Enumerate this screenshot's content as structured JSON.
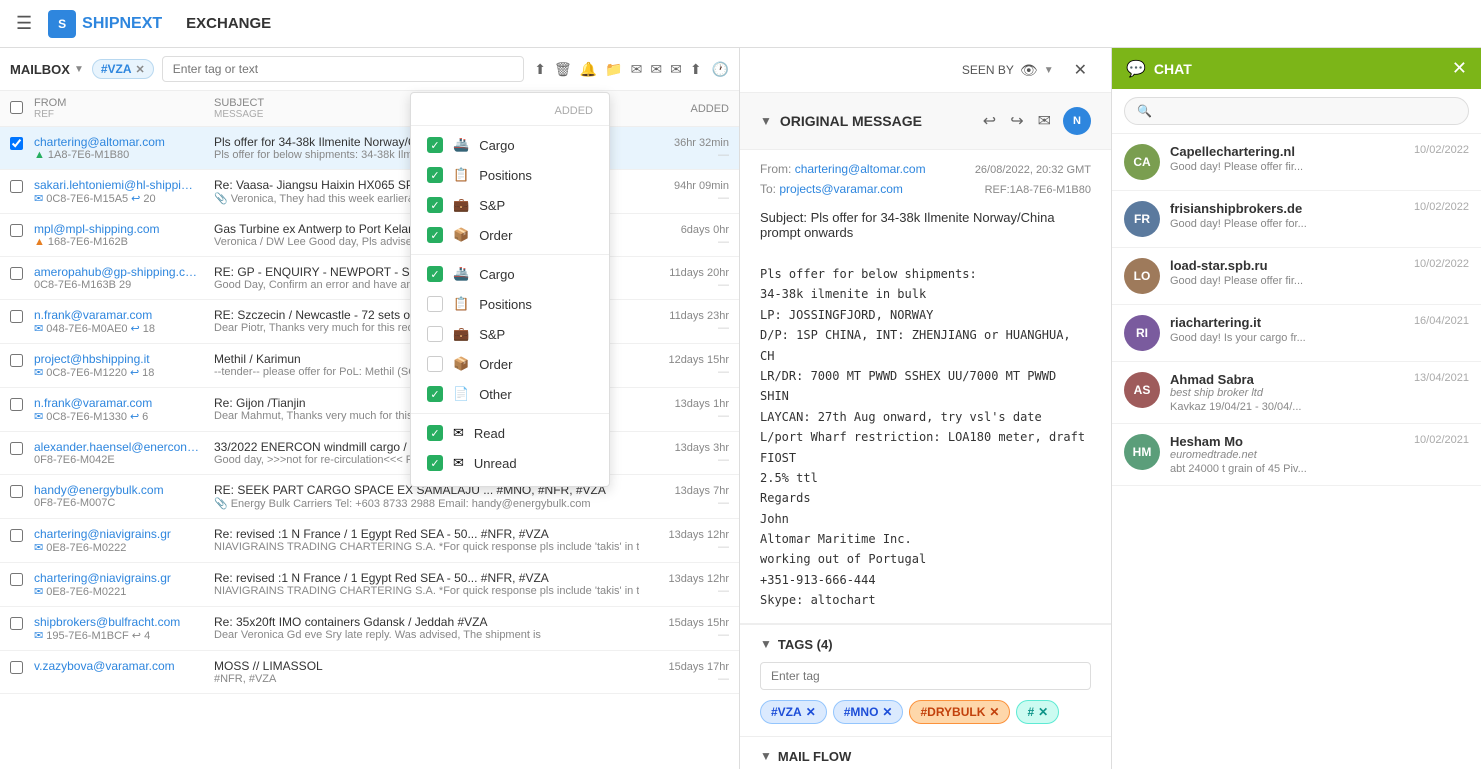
{
  "nav": {
    "hamburger": "☰",
    "logo_text": "SHIPNEXT",
    "title": "EXCHANGE"
  },
  "mailbox": {
    "label": "MAILBOX",
    "tag_chip": "#VZA",
    "search_placeholder": "Enter tag or text",
    "columns": {
      "from": "FROM",
      "ref": "REF",
      "subject": "SUBJECT",
      "message": "MESSAGE",
      "added": "ADDED"
    }
  },
  "dropdown": {
    "header_left": "",
    "header_right": "ADDED",
    "items": [
      {
        "id": "cargo1",
        "checked": true,
        "icon": "🚢",
        "label": "Cargo"
      },
      {
        "id": "positions",
        "checked": true,
        "icon": "📋",
        "label": "Positions"
      },
      {
        "id": "snp",
        "checked": true,
        "icon": "💼",
        "label": "S&P"
      },
      {
        "id": "order",
        "checked": true,
        "icon": "📦",
        "label": "Order"
      },
      {
        "id": "cargo2",
        "checked": true,
        "icon": "🚢",
        "label": "Cargo"
      },
      {
        "id": "positions2",
        "checked": false,
        "icon": "📋",
        "label": "Positions"
      },
      {
        "id": "snp2",
        "checked": false,
        "icon": "💼",
        "label": "S&P"
      },
      {
        "id": "order2",
        "checked": false,
        "icon": "📦",
        "label": "Order"
      },
      {
        "id": "other",
        "checked": true,
        "icon": "📄",
        "label": "Other"
      },
      {
        "id": "read",
        "checked": true,
        "icon": "✉",
        "label": "Read"
      },
      {
        "id": "unread",
        "checked": true,
        "icon": "✉",
        "label": "Unread"
      }
    ]
  },
  "emails": [
    {
      "from": "chartering@altomar.com",
      "ref": "1A8-7E6-M1B80",
      "ref_icon": "green",
      "subject": "Pls offer for 34-38k Ilmenite Norway/China pr...",
      "preview": "Pls offer for below shipments: 34-38k Ilmenite",
      "time": "36hr 32min",
      "selected": true,
      "has_attach": false
    },
    {
      "from": "sakari.lehtoniemi@hl-shipping...",
      "ref": "0C8-7E6-M15A5",
      "ref_icon": "blue",
      "ref_count": "20",
      "subject": "Re: Vaasa- Jiangsu Haixin HX065 SP/06016 S...",
      "preview": "Veronica, They had this week earlier& cheap",
      "time": "94hr 09min",
      "has_attach": true
    },
    {
      "from": "mpl@mpl-shipping.com",
      "ref": "168-7E6-M162B",
      "ref_icon": "orange",
      "subject": "Gas Turbine ex Antwerp to Port Kelang",
      "preview": "Veronica / DW Lee Good day, Pls advise you",
      "time": "6days 0hr"
    },
    {
      "from": "ameropahub@gp-shipping.com",
      "ref": "0C8-7E6-M163B",
      "ref_count": "29",
      "subject": "RE: GP - ENQUIRY - NEWPORT - SKYSTAR (AM...",
      "preview": "Good Day, Confirm an error and have amen...",
      "time": "11days 20hr"
    },
    {
      "from": "n.frank@varamar.com",
      "ref": "048-7E6-M0AE0",
      "ref_count": "18",
      "subject": "RE: Szczecin / Newcastle - 72 sets of anode c...",
      "preview": "Dear Piotr, Thanks very much for this requ",
      "time": "11days 23hr",
      "has_email": true
    },
    {
      "from": "project@hbshipping.it",
      "ref": "0C8-7E6-M1220",
      "ref_count": "18",
      "subject": "Methil / Karimun",
      "preview": "--tender-- please offer for PoL: Methil (SC)",
      "time": "12days 15hr",
      "has_email": true
    },
    {
      "from": "n.frank@varamar.com",
      "ref": "0C8-7E6-M1330",
      "ref_count": "6",
      "subject": "Re: Gijon /Tianjin",
      "preview": "Dear Mahmut, Thanks very much for this r",
      "time": "13days 1hr",
      "has_email": true
    },
    {
      "from": "alexander.haensel@enercon.de",
      "ref": "0F8-7E6-M042E",
      "subject": "33/2022 ENERCON windmill cargo / france",
      "preview": "Good day, >>>not for re-circulation<<< Ple...",
      "time": "13days 3hr",
      "has_email": true
    },
    {
      "from": "handy@energybulk.com",
      "ref": "0F8-7E6-M007C",
      "subject": "RE: SEEK PART CARGO SPACE EX SAMALAJU ... #MNO, #NFR, #VZA",
      "preview": "Energy Bulk Carriers Tel: +603 8733 2988 Email: handy@energybulk.com",
      "time": "13days 7hr",
      "has_email": true
    },
    {
      "from": "chartering@niavigrains.gr",
      "ref": "0E8-7E6-M0222",
      "subject": "Re: revised :1 N France / 1 Egypt Red SEA - 50... #NFR, #VZA",
      "preview": "NIAVIGRAINS TRADING CHARTERING S.A. *For quick response pls include 'takis' in t",
      "time": "13days 12hr",
      "has_email": true
    },
    {
      "from": "chartering@niavigrains.gr",
      "ref": "0E8-7E6-M0221",
      "subject": "Re: revised :1 N France / 1 Egypt Red SEA - 50... #NFR, #VZA",
      "preview": "NIAVIGRAINS TRADING CHARTERING S.A. *For quick response pls include 'takis' in t",
      "time": "13days 12hr",
      "has_email": true
    },
    {
      "from": "shipbrokers@bulfracht.com",
      "ref": "195-7E6-M1BCF",
      "ref_count": "4",
      "subject": "Re: 35x20ft IMO containers Gdansk / Jeddah   #VZA",
      "preview": "Dear Veronica  Gd eve   Sry late reply.  Was advised, The shipment is",
      "time": "15days 15hr",
      "has_email": true
    },
    {
      "from": "v.zazybova@varamar.com",
      "ref": "",
      "subject": "MOSS // LIMASSOL",
      "preview": "#NFR, #VZA",
      "time": "15days 17hr"
    }
  ],
  "message": {
    "section_title": "ORIGINAL MESSAGE",
    "from_label": "From:",
    "from_email": "chartering@altomar.com",
    "to_label": "To:",
    "to_email": "projects@varamar.com",
    "date": "26/08/2022, 20:32 GMT",
    "ref": "REF:1A8-7E6-M1B80",
    "subject_label": "Subject:",
    "subject": "Pls offer for 34-38k Ilmenite Norway/China prompt onwards",
    "body": "Pls offer for below shipments:\n34-38k ilmenite in bulk\nLP: JOSSINGFJORD, NORWAY\nD/P: 1SP CHINA, INT: ZHENJIANG or HUANGHUA, CH\nLR/DR: 7000 MT PWWD SSHEX UU/7000 MT PWWD SHIN\nLAYCAN: 27th Aug onward, try vsl's date\nL/port Wharf restriction: LOA180 meter, draft\nFIOST\n2.5% ttl\nRegards\nJohn\nAltomar Maritime Inc.\nworking out of Portugal\n+351-913-666-444\nSkype: altochart"
  },
  "tags": {
    "section_title": "TAGS (4)",
    "input_placeholder": "Enter tag",
    "items": [
      {
        "label": "#VZA",
        "color": "blue"
      },
      {
        "label": "#MNO",
        "color": "blue"
      },
      {
        "label": "#DRYBULK",
        "color": "orange"
      },
      {
        "label": "#...",
        "color": "teal"
      }
    ]
  },
  "mailflow": {
    "title": "MAIL FLOW"
  },
  "seen_by": "SEEN BY",
  "close_label": "✕",
  "chat": {
    "title": "CHAT",
    "search_placeholder": "🔍",
    "contacts": [
      {
        "initials": "CA",
        "color": "#7a9e50",
        "name": "Capellechartering.nl",
        "company": "",
        "preview": "Good day! Please offer fir...",
        "date": "10/02/2022"
      },
      {
        "initials": "FR",
        "color": "#5b7a9e",
        "name": "frisianshipbrokers.de",
        "company": "",
        "preview": "Good day! Please offer for...",
        "date": "10/02/2022"
      },
      {
        "initials": "LO",
        "color": "#9e7a5b",
        "name": "load-star.spb.ru",
        "company": "",
        "preview": "Good day! Please offer fir...",
        "date": "10/02/2022"
      },
      {
        "initials": "RI",
        "color": "#7a5b9e",
        "name": "riachartering.it",
        "company": "",
        "preview": "Good day! Is your cargo fr...",
        "date": "16/04/2021"
      },
      {
        "initials": "AS",
        "color": "#9e5b5b",
        "name": "Ahmad Sabra",
        "company": "best ship broker ltd",
        "preview": "Kavkaz 19/04/21 - 30/04/...",
        "date": "13/04/2021"
      },
      {
        "initials": "HM",
        "color": "#5b9e7a",
        "name": "Hesham Mo",
        "company": "euromedtrade.net",
        "preview": "abt 24000 t grain of 45 Piv...",
        "date": "10/02/2021"
      }
    ]
  }
}
